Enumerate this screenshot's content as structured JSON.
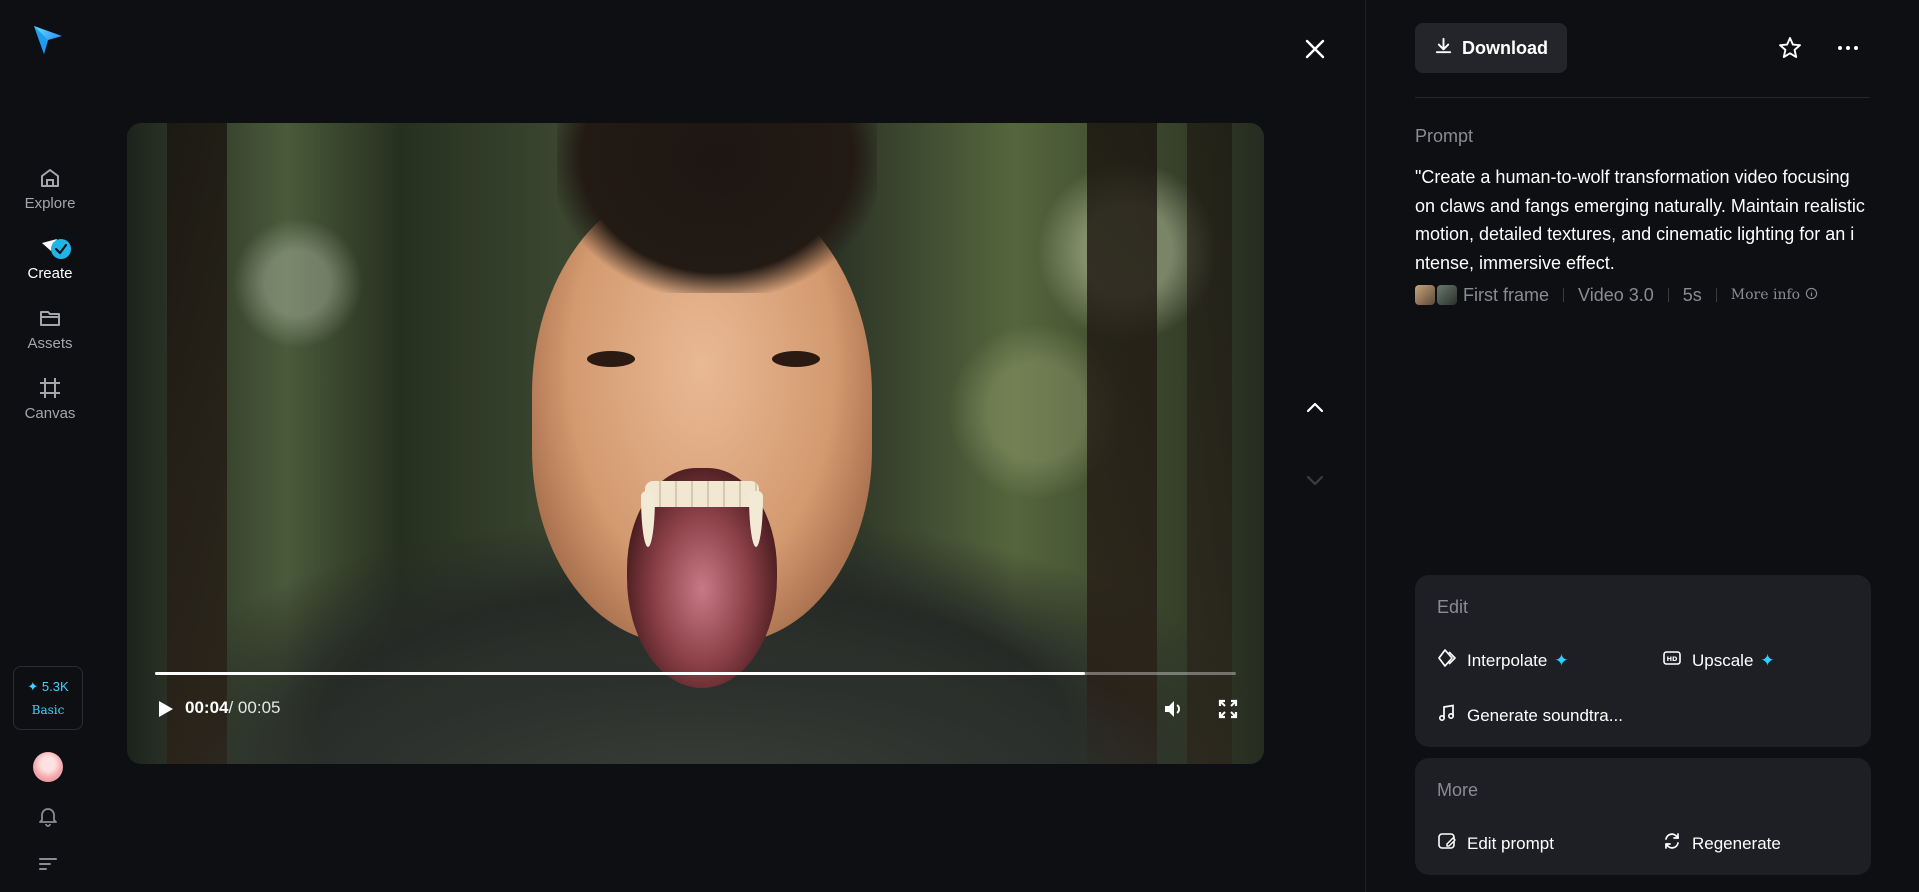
{
  "sidebar": {
    "items": [
      {
        "label": "Explore",
        "icon": "home-icon"
      },
      {
        "label": "Create",
        "icon": "create-icon",
        "active": true
      },
      {
        "label": "Assets",
        "icon": "folder-icon"
      },
      {
        "label": "Canvas",
        "icon": "canvas-icon"
      }
    ],
    "credits": {
      "amount": "✦ 5.3K",
      "plan": "Basic"
    }
  },
  "player": {
    "current_time": "00:04",
    "total_time": "/ 00:05",
    "progress": 0.86
  },
  "panel": {
    "download_label": "Download",
    "prompt_heading": "Prompt",
    "prompt_lines": [
      "\"Create a human-to-wolf transformation video focusing",
      "on claws and fangs emerging naturally. Maintain realistic",
      "motion, detailed textures, and cinematic lighting for an i",
      "ntense, immersive effect."
    ],
    "meta": {
      "reference": "First frame",
      "model": "Video 3.0",
      "duration": "5s",
      "more_info": "More info"
    },
    "edit": {
      "title": "Edit",
      "interpolate": "Interpolate",
      "upscale": "Upscale",
      "soundtrack": "Generate soundtra..."
    },
    "more": {
      "title": "More",
      "edit_prompt": "Edit prompt",
      "regenerate": "Regenerate"
    }
  },
  "colors": {
    "accent": "#2cd1ff",
    "background": "#0e0f12",
    "card": "#1e1f25"
  }
}
